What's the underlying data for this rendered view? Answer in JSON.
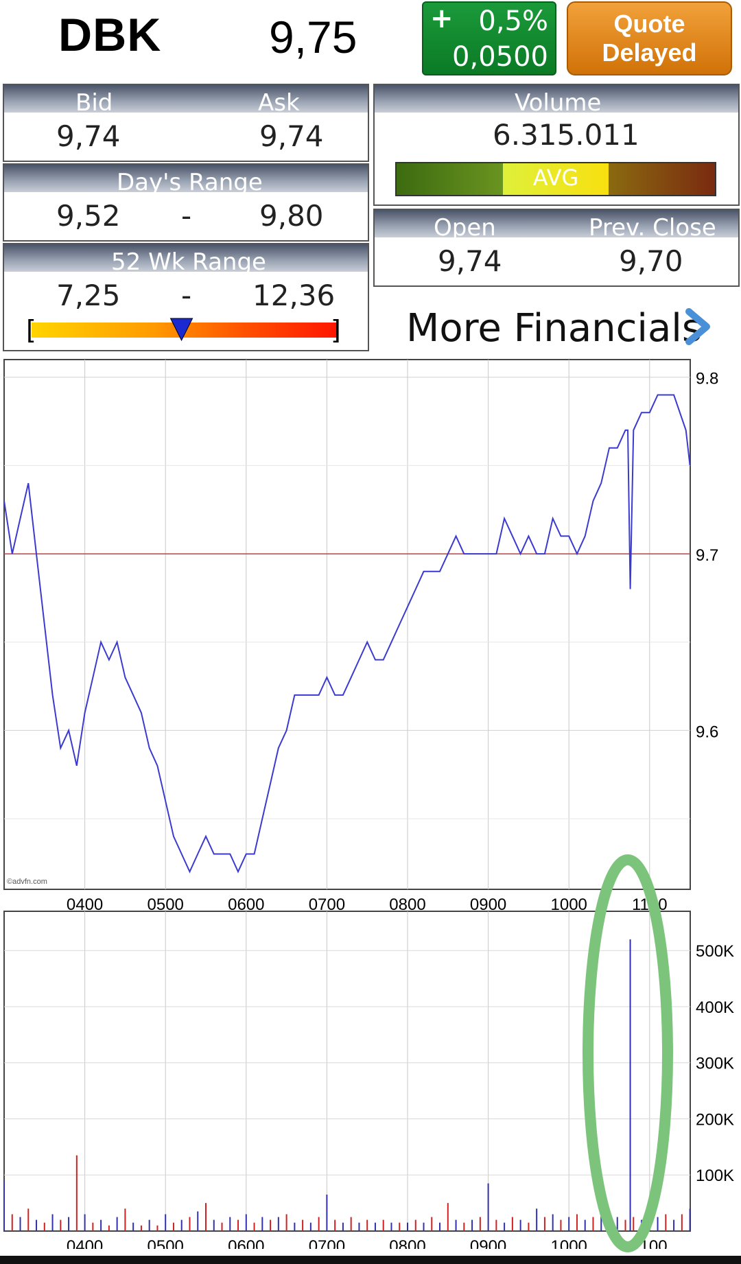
{
  "header": {
    "symbol": "DBK",
    "price": "9,75",
    "change_sign": "+",
    "change_pct": "0,5%",
    "change_abs": "0,0500",
    "quote_line1": "Quote",
    "quote_line2": "Delayed"
  },
  "bid_ask": {
    "bid_label": "Bid",
    "ask_label": "Ask",
    "bid": "9,74",
    "ask": "9,74"
  },
  "volume": {
    "label": "Volume",
    "value": "6.315.011",
    "avg_label": "AVG"
  },
  "days_range": {
    "label": "Day's Range",
    "low": "9,52",
    "dash": "-",
    "high": "9,80"
  },
  "open_close": {
    "open_label": "Open",
    "prev_label": "Prev. Close",
    "open": "9,74",
    "prev": "9,70"
  },
  "wk52": {
    "label": "52 Wk Range",
    "low": "7,25",
    "dash": "-",
    "high": "12,36",
    "marker_fraction": 0.49
  },
  "more_financials": "More Financials",
  "colors": {
    "up_green": "#0b7a25",
    "delayed_orange": "#d07208",
    "price_line": "#3a3ad0",
    "volume_red": "#d02020"
  },
  "chart_data": [
    {
      "type": "line",
      "watermark": "©advfn.com",
      "x_ticks": [
        "0400",
        "0500",
        "0600",
        "0700",
        "0800",
        "0900",
        "1000",
        "1100"
      ],
      "y_ticks": [
        "9.8",
        "9.7",
        "9.6"
      ],
      "ylim": [
        9.51,
        9.81
      ],
      "reference_line": 9.7,
      "series": [
        {
          "x": [
            3.0,
            3.1,
            3.2,
            3.3,
            3.4,
            3.5,
            3.6,
            3.7,
            3.8,
            3.9,
            4.0,
            4.1,
            4.2,
            4.3,
            4.4,
            4.5,
            4.6,
            4.7,
            4.8,
            4.9,
            5.0,
            5.1,
            5.2,
            5.3,
            5.4,
            5.5,
            5.6,
            5.7,
            5.8,
            5.9,
            6.0,
            6.1,
            6.2,
            6.3,
            6.4,
            6.5,
            6.6,
            6.7,
            6.8,
            6.9,
            7.0,
            7.1,
            7.2,
            7.3,
            7.4,
            7.5,
            7.6,
            7.7,
            7.8,
            7.9,
            8.0,
            8.1,
            8.2,
            8.3,
            8.4,
            8.5,
            8.6,
            8.7,
            8.8,
            8.9,
            9.0,
            9.1,
            9.2,
            9.3,
            9.4,
            9.5,
            9.6,
            9.7,
            9.8,
            9.9,
            10.0,
            10.1,
            10.2,
            10.3,
            10.4,
            10.5,
            10.6,
            10.7,
            10.73,
            10.76,
            10.8,
            10.9,
            11.0,
            11.1,
            11.2,
            11.3,
            11.45,
            11.5
          ],
          "y": [
            9.73,
            9.7,
            9.72,
            9.74,
            9.7,
            9.66,
            9.62,
            9.59,
            9.6,
            9.58,
            9.61,
            9.63,
            9.65,
            9.64,
            9.65,
            9.63,
            9.62,
            9.61,
            9.59,
            9.58,
            9.56,
            9.54,
            9.53,
            9.52,
            9.53,
            9.54,
            9.53,
            9.53,
            9.53,
            9.52,
            9.53,
            9.53,
            9.55,
            9.57,
            9.59,
            9.6,
            9.62,
            9.62,
            9.62,
            9.62,
            9.63,
            9.62,
            9.62,
            9.63,
            9.64,
            9.65,
            9.64,
            9.64,
            9.65,
            9.66,
            9.67,
            9.68,
            9.69,
            9.69,
            9.69,
            9.7,
            9.71,
            9.7,
            9.7,
            9.7,
            9.7,
            9.7,
            9.72,
            9.71,
            9.7,
            9.71,
            9.7,
            9.7,
            9.72,
            9.71,
            9.71,
            9.7,
            9.71,
            9.73,
            9.74,
            9.76,
            9.76,
            9.77,
            9.77,
            9.68,
            9.77,
            9.78,
            9.78,
            9.79,
            9.79,
            9.79,
            9.77,
            9.75
          ]
        }
      ]
    },
    {
      "type": "bar",
      "x_ticks": [
        "0400",
        "0500",
        "0600",
        "0700",
        "0800",
        "0900",
        "1000",
        "1100"
      ],
      "y_ticks": [
        "500K",
        "400K",
        "300K",
        "200K",
        "100K"
      ],
      "ylim": [
        0,
        570000
      ],
      "x": [
        3.0,
        3.1,
        3.2,
        3.3,
        3.4,
        3.5,
        3.6,
        3.7,
        3.8,
        3.9,
        4.0,
        4.1,
        4.2,
        4.3,
        4.4,
        4.5,
        4.6,
        4.7,
        4.8,
        4.9,
        5.0,
        5.1,
        5.2,
        5.3,
        5.4,
        5.5,
        5.6,
        5.7,
        5.8,
        5.9,
        6.0,
        6.1,
        6.2,
        6.3,
        6.4,
        6.5,
        6.6,
        6.7,
        6.8,
        6.9,
        7.0,
        7.1,
        7.2,
        7.3,
        7.4,
        7.5,
        7.6,
        7.7,
        7.8,
        7.9,
        8.0,
        8.1,
        8.2,
        8.3,
        8.4,
        8.5,
        8.6,
        8.7,
        8.8,
        8.9,
        9.0,
        9.1,
        9.2,
        9.3,
        9.4,
        9.5,
        9.6,
        9.7,
        9.8,
        9.9,
        10.0,
        10.1,
        10.2,
        10.3,
        10.4,
        10.5,
        10.6,
        10.7,
        10.76,
        10.8,
        10.9,
        11.0,
        11.1,
        11.2,
        11.3,
        11.4,
        11.5
      ],
      "values": [
        90000,
        30000,
        25000,
        40000,
        20000,
        15000,
        30000,
        20000,
        25000,
        135000,
        30000,
        15000,
        20000,
        10000,
        25000,
        40000,
        15000,
        10000,
        20000,
        10000,
        30000,
        15000,
        20000,
        25000,
        35000,
        50000,
        20000,
        15000,
        25000,
        20000,
        30000,
        15000,
        25000,
        20000,
        25000,
        30000,
        15000,
        20000,
        15000,
        25000,
        65000,
        20000,
        15000,
        25000,
        15000,
        20000,
        15000,
        20000,
        15000,
        15000,
        15000,
        20000,
        15000,
        25000,
        15000,
        50000,
        20000,
        15000,
        20000,
        25000,
        85000,
        20000,
        15000,
        25000,
        20000,
        15000,
        40000,
        25000,
        30000,
        20000,
        25000,
        30000,
        20000,
        25000,
        30000,
        15000,
        25000,
        20000,
        520000,
        25000,
        20000,
        30000,
        25000,
        30000,
        20000,
        30000,
        40000
      ]
    }
  ]
}
